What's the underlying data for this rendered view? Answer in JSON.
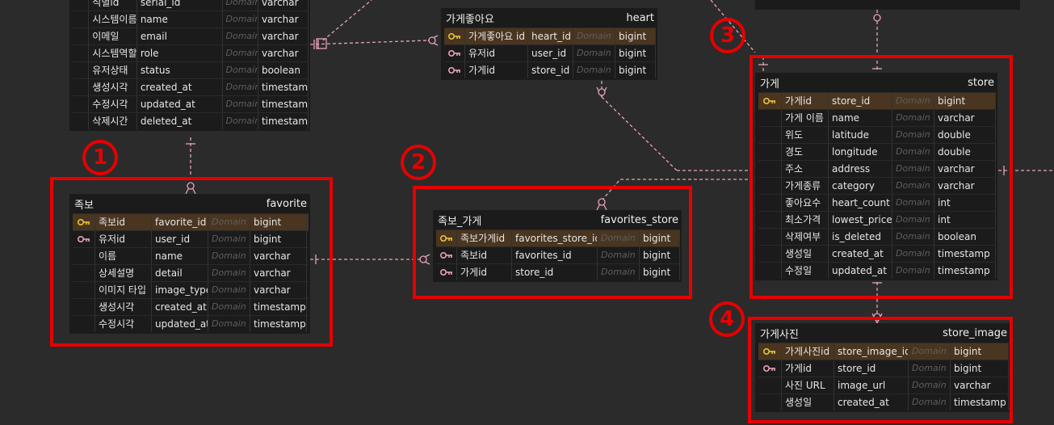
{
  "legend_type": "Domain",
  "colors": {
    "pk_row": "#4a3520",
    "pk_key": "#e8c33a",
    "fk_key": "#e7a3b4",
    "line": "#e7a3b4",
    "highlight": "#e60000"
  },
  "annotations": [
    "1",
    "2",
    "3",
    "4"
  ],
  "entities": {
    "user": {
      "rows": [
        {
          "logical": "식별id",
          "physical": "serial_id",
          "domain": "Domain",
          "type": "varchar"
        },
        {
          "logical": "시스템이름",
          "physical": "name",
          "domain": "Domain",
          "type": "varchar"
        },
        {
          "logical": "이메일",
          "physical": "email",
          "domain": "Domain",
          "type": "varchar"
        },
        {
          "logical": "시스템역할",
          "physical": "role",
          "domain": "Domain",
          "type": "varchar"
        },
        {
          "logical": "유저상태",
          "physical": "status",
          "domain": "Domain",
          "type": "boolean"
        },
        {
          "logical": "생성시각",
          "physical": "created_at",
          "domain": "Domain",
          "type": "timestamp"
        },
        {
          "logical": "수정시각",
          "physical": "updated_at",
          "domain": "Domain",
          "type": "timestamp"
        },
        {
          "logical": "삭제시간",
          "physical": "deleted_at",
          "domain": "Domain",
          "type": "timestamp"
        }
      ]
    },
    "heart": {
      "title": "가게좋아요",
      "name": "heart",
      "rows": [
        {
          "key": "pk",
          "logical": "가게좋아요 id",
          "physical": "heart_id",
          "domain": "Domain",
          "type": "bigint"
        },
        {
          "key": "fk",
          "logical": "유저id",
          "physical": "user_id",
          "domain": "Domain",
          "type": "bigint"
        },
        {
          "key": "fk",
          "logical": "가게id",
          "physical": "store_id",
          "domain": "Domain",
          "type": "bigint"
        }
      ]
    },
    "favorite": {
      "title": "족보",
      "name": "favorite",
      "rows": [
        {
          "key": "pk",
          "logical": "족보id",
          "physical": "favorite_id",
          "domain": "Domain",
          "type": "bigint"
        },
        {
          "key": "fk",
          "logical": "유저id",
          "physical": "user_id",
          "domain": "Domain",
          "type": "bigint"
        },
        {
          "logical": "이름",
          "physical": "name",
          "domain": "Domain",
          "type": "varchar"
        },
        {
          "logical": "상세설명",
          "physical": "detail",
          "domain": "Domain",
          "type": "varchar"
        },
        {
          "logical": "이미지 타입",
          "physical": "image_type",
          "domain": "Domain",
          "type": "varchar"
        },
        {
          "logical": "생성시각",
          "physical": "created_at",
          "domain": "Domain",
          "type": "timestamp"
        },
        {
          "logical": "수정시각",
          "physical": "updated_at",
          "domain": "Domain",
          "type": "timestamp"
        }
      ]
    },
    "favorites_store": {
      "title": "족보_가게",
      "name": "favorites_store",
      "rows": [
        {
          "key": "pk",
          "logical": "족보가게id",
          "physical": "favorites_store_id",
          "domain": "Domain",
          "type": "bigint"
        },
        {
          "key": "fk",
          "logical": "족보id",
          "physical": "favorites_id",
          "domain": "Domain",
          "type": "bigint"
        },
        {
          "key": "fk",
          "logical": "가게id",
          "physical": "store_id",
          "domain": "Domain",
          "type": "bigint"
        }
      ]
    },
    "store": {
      "title": "가게",
      "name": "store",
      "rows": [
        {
          "key": "pk",
          "logical": "가게id",
          "physical": "store_id",
          "domain": "Domain",
          "type": "bigint"
        },
        {
          "logical": "가게 이름",
          "physical": "name",
          "domain": "Domain",
          "type": "varchar"
        },
        {
          "logical": "위도",
          "physical": "latitude",
          "domain": "Domain",
          "type": "double"
        },
        {
          "logical": "경도",
          "physical": "longitude",
          "domain": "Domain",
          "type": "double"
        },
        {
          "logical": "주소",
          "physical": "address",
          "domain": "Domain",
          "type": "varchar"
        },
        {
          "logical": "가게종류",
          "physical": "category",
          "domain": "Domain",
          "type": "varchar"
        },
        {
          "logical": "좋아요수",
          "physical": "heart_count",
          "domain": "Domain",
          "type": "int"
        },
        {
          "logical": "최소가격",
          "physical": "lowest_price",
          "domain": "Domain",
          "type": "int"
        },
        {
          "logical": "삭제여부",
          "physical": "is_deleted",
          "domain": "Domain",
          "type": "boolean"
        },
        {
          "logical": "생성일",
          "physical": "created_at",
          "domain": "Domain",
          "type": "timestamp"
        },
        {
          "logical": "수정일",
          "physical": "updated_at",
          "domain": "Domain",
          "type": "timestamp"
        }
      ]
    },
    "store_image": {
      "title": "가게사진",
      "name": "store_image",
      "rows": [
        {
          "key": "pk",
          "logical": "가게사진id",
          "physical": "store_image_id",
          "domain": "Domain",
          "type": "bigint"
        },
        {
          "key": "fk",
          "logical": "가게id",
          "physical": "store_id",
          "domain": "Domain",
          "type": "bigint"
        },
        {
          "logical": "사진 URL",
          "physical": "image_url",
          "domain": "Domain",
          "type": "varchar"
        },
        {
          "logical": "생성일",
          "physical": "created_at",
          "domain": "Domain",
          "type": "timestamp"
        }
      ]
    }
  }
}
